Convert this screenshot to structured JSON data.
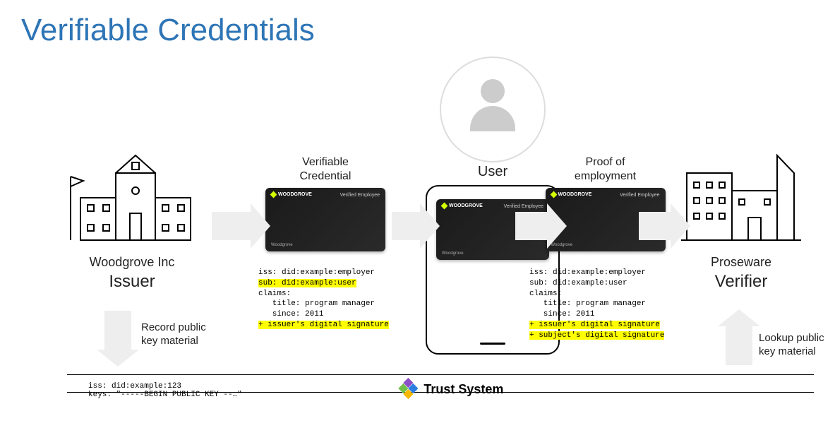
{
  "title": "Verifiable Credentials",
  "issuer": {
    "name": "Woodgrove Inc",
    "role": "Issuer"
  },
  "user": {
    "label": "User"
  },
  "verifier": {
    "name": "Proseware",
    "role": "Verifier"
  },
  "vc_label": "Verifiable\nCredential",
  "proof_label": "Proof of\nemployment",
  "card": {
    "brand": "WOODGROVE",
    "type": "Verified Employee",
    "footer": "Woodgrove"
  },
  "vc_code": {
    "l1": "iss: did:example:employer",
    "l2": "sub: did:example:user",
    "l3": "claims:",
    "l4": "   title: program manager",
    "l5": "   since: 2011",
    "l6": "+ issuer's digital signature"
  },
  "proof_code": {
    "l1": "iss: did:example:employer",
    "l2": "sub: did:example:user",
    "l3": "claims:",
    "l4": "   title: program manager",
    "l5": "   since: 2011",
    "l6": "+ issuer's digital signature",
    "l7": "+ subject's digital signature"
  },
  "record_label": "Record public\nkey material",
  "lookup_label": "Lookup public\nkey material",
  "trust": {
    "label": "Trust System",
    "code": "iss: did:example:123\nkeys: \"-----BEGIN PUBLIC KEY --…\""
  }
}
